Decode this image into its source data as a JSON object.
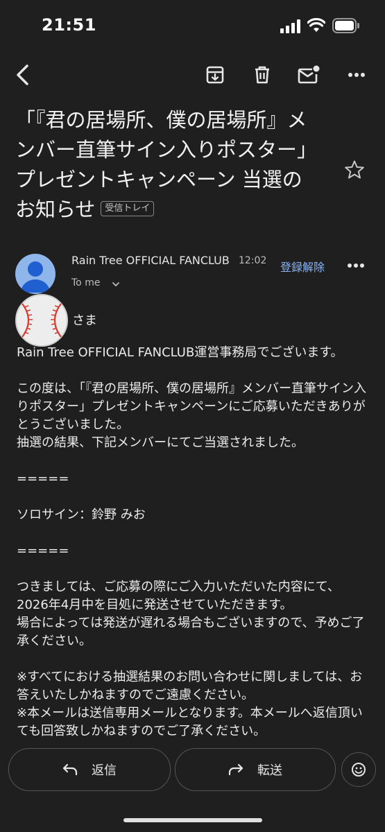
{
  "status_bar": {
    "time": "21:51"
  },
  "email": {
    "subject": "「『君の居場所、僕の居場所』メンバー直筆サイン入りポスター」プレゼントキャンペーン 当選のお知らせ",
    "label": "受信トレイ",
    "sender_name": "Rain Tree OFFICIAL FANCLUB",
    "time": "12:02",
    "unsubscribe": "登録解除",
    "recipient": "To me",
    "salutation": "さま",
    "body": [
      "Rain Tree OFFICIAL FANCLUB運営事務局でございます。",
      "",
      "この度は、「『君の居場所、僕の居場所』メンバー直筆サイン入りポスター」プレゼントキャンペーンにご応募いただきありがとうございました。",
      "抽選の結果、下記メンバーにてご当選されました。",
      "",
      "=====",
      "",
      "ソロサイン：鈴野 みお",
      "",
      "=====",
      "",
      "つきましては、ご応募の際にご入力いただいた内容にて、",
      "2026年4月中を目処に発送させていただきます。",
      "場合によっては発送が遅れる場合もございますので、予めご了承ください。",
      "",
      "※すべてにおける抽選結果のお問い合わせに関しましては、お答えいたしかねますのでご遠慮ください。",
      "※本メールは送信専用メールとなります。本メールへ返信頂いても回答致しかねますのでご了承ください。"
    ]
  },
  "actions": {
    "reply": "返信",
    "forward": "転送"
  },
  "icons": [
    "back-icon",
    "archive-icon",
    "delete-icon",
    "mark-unread-icon",
    "more-icon",
    "star-icon",
    "chevron-down-icon",
    "reply-icon",
    "forward-icon",
    "emoji-icon"
  ],
  "colors": {
    "background": "#1f1f1f",
    "link": "#8ab4f8",
    "avatar": "#8fb6ea"
  }
}
